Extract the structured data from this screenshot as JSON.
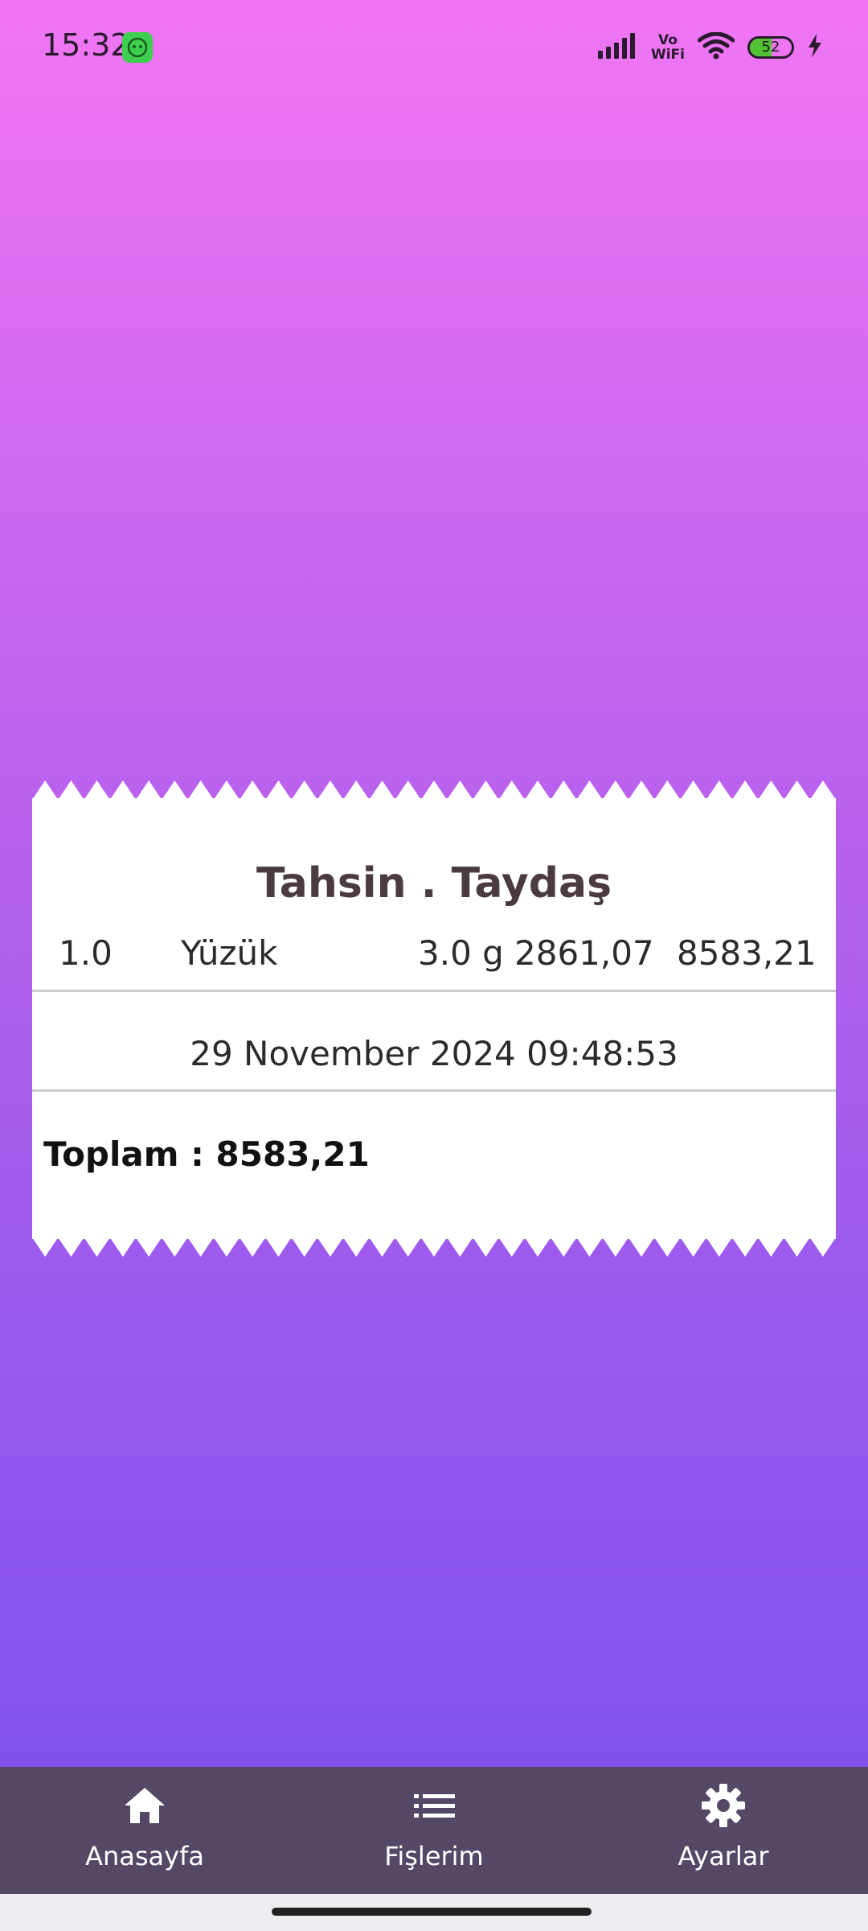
{
  "status_bar": {
    "time": "15:32",
    "app_icon": "android-notification-icon",
    "signal_icon": "signal-bars-icon",
    "vowifi_line1": "Vo",
    "vowifi_line2": "WiFi",
    "wifi_icon": "wifi-icon",
    "battery_level": "52",
    "battery_percent": 52,
    "charging_icon": "lightning-icon"
  },
  "receipt": {
    "customer_name": "Tahsin . Taydaş",
    "items": [
      {
        "quantity": "1.0",
        "name": "Yüzük",
        "weight": "3.0 g",
        "unit_price": "2861,07",
        "total": "8583,21"
      }
    ],
    "date": "29 November 2024 09:48:53",
    "total_text": "Toplam : 8583,21"
  },
  "bottom_nav": {
    "items": [
      {
        "label": "Anasayfa",
        "icon": "home-icon"
      },
      {
        "label": "Fişlerim",
        "icon": "list-icon"
      },
      {
        "label": "Ayarlar",
        "icon": "gear-icon"
      }
    ]
  },
  "colors": {
    "gradient_top": "#f176f3",
    "gradient_bottom": "#7c4cec",
    "nav_background": "#554766",
    "title_color": "#4c3b3e"
  }
}
